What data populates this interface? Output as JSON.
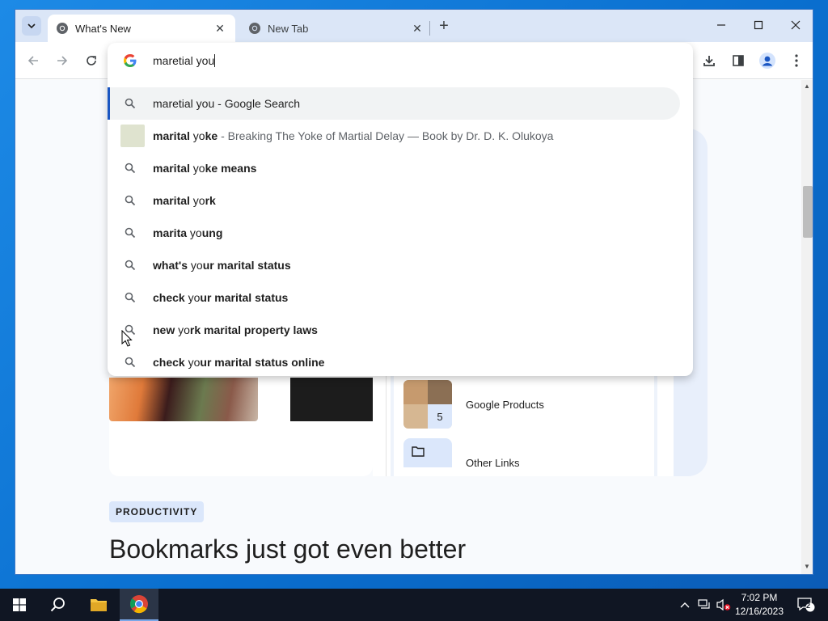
{
  "tabs": [
    {
      "title": "What's New",
      "active": true
    },
    {
      "title": "New Tab",
      "active": false
    }
  ],
  "omnibox": {
    "query": "maretial you",
    "suggestions": [
      {
        "type": "search",
        "parts": [
          {
            "t": "maretial you - Google Search",
            "b": false
          }
        ],
        "selected": true
      },
      {
        "type": "entity",
        "parts": [
          {
            "t": "marital",
            "b": true
          },
          {
            "t": " yo",
            "b": false
          },
          {
            "t": "ke",
            "b": true
          }
        ],
        "description": " - Breaking The Yoke of Martial Delay — Book by Dr. D. K. Olukoya"
      },
      {
        "type": "search",
        "parts": [
          {
            "t": "marital",
            "b": true
          },
          {
            "t": " yo",
            "b": false
          },
          {
            "t": "ke means",
            "b": true
          }
        ]
      },
      {
        "type": "search",
        "parts": [
          {
            "t": "marital",
            "b": true
          },
          {
            "t": " yo",
            "b": false
          },
          {
            "t": "rk",
            "b": true
          }
        ]
      },
      {
        "type": "search",
        "parts": [
          {
            "t": "marita",
            "b": true
          },
          {
            "t": " yo",
            "b": false
          },
          {
            "t": "ung",
            "b": true
          }
        ]
      },
      {
        "type": "search",
        "parts": [
          {
            "t": "what's",
            "b": true
          },
          {
            "t": " yo",
            "b": false
          },
          {
            "t": "ur marital status",
            "b": true
          }
        ]
      },
      {
        "type": "search",
        "parts": [
          {
            "t": "check",
            "b": true
          },
          {
            "t": " yo",
            "b": false
          },
          {
            "t": "ur marital status",
            "b": true
          }
        ]
      },
      {
        "type": "search",
        "parts": [
          {
            "t": "new",
            "b": true
          },
          {
            "t": " yo",
            "b": false
          },
          {
            "t": "rk marital property laws",
            "b": true
          }
        ]
      },
      {
        "type": "search",
        "parts": [
          {
            "t": "check",
            "b": true
          },
          {
            "t": " yo",
            "b": false
          },
          {
            "t": "ur marital status online",
            "b": true
          }
        ]
      }
    ]
  },
  "page": {
    "bookmark_items": [
      {
        "label": "Google Products",
        "count": "5",
        "icon": "photo-collage"
      },
      {
        "label": "Other Links",
        "icon": "folder-icon"
      }
    ],
    "badge": "PRODUCTIVITY",
    "headline": "Bookmarks just got even better"
  },
  "taskbar": {
    "time": "7:02 PM",
    "date": "12/16/2023",
    "notification_count": "2"
  },
  "colors": {
    "accent": "#1a56c2",
    "tabstrip": "#dbe6f7",
    "taskbar": "#101623"
  }
}
